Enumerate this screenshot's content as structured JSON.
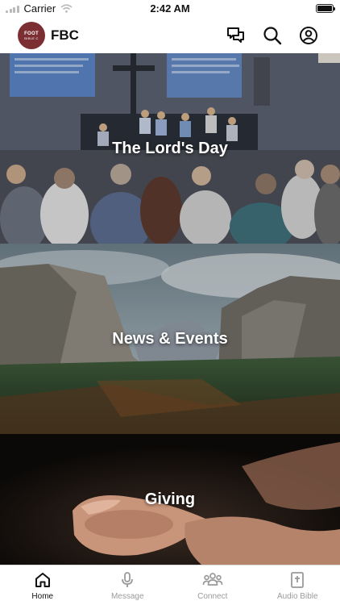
{
  "status_bar": {
    "carrier": "Carrier",
    "time": "2:42 AM"
  },
  "header": {
    "logo_line1": "FOOT",
    "logo_line2": "BIBLE C",
    "title": "FBC",
    "icons": [
      "chat-icon",
      "search-icon",
      "profile-icon"
    ]
  },
  "tiles": [
    {
      "label": "The Lord's Day"
    },
    {
      "label": "News & Events"
    },
    {
      "label": "Giving"
    }
  ],
  "tabs": [
    {
      "label": "Home",
      "icon": "home-icon",
      "active": true
    },
    {
      "label": "Message",
      "icon": "microphone-icon",
      "active": false
    },
    {
      "label": "Connect",
      "icon": "people-icon",
      "active": false
    },
    {
      "label": "Audio Bible",
      "icon": "bible-icon",
      "active": false
    }
  ],
  "colors": {
    "brand": "#7b2f33",
    "active_tab": "#111111",
    "inactive_tab": "#9a9a9a"
  }
}
